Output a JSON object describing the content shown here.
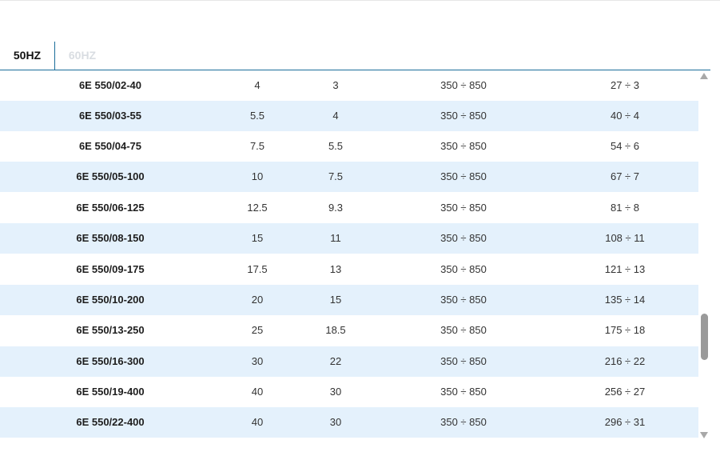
{
  "tabs": [
    {
      "label": "50HZ",
      "active": true
    },
    {
      "label": "60HZ",
      "active": false
    }
  ],
  "colors": {
    "accent": "#1a6d9a",
    "row_alt_bg": "#e4f1fc",
    "inactive_tab": "#d9dde2"
  },
  "table": {
    "rows": [
      [
        "6E 550/02-40",
        "4",
        "3",
        "350 ÷ 850",
        "27 ÷ 3"
      ],
      [
        "6E 550/03-55",
        "5.5",
        "4",
        "350 ÷ 850",
        "40 ÷ 4"
      ],
      [
        "6E 550/04-75",
        "7.5",
        "5.5",
        "350 ÷ 850",
        "54 ÷ 6"
      ],
      [
        "6E 550/05-100",
        "10",
        "7.5",
        "350 ÷ 850",
        "67 ÷ 7"
      ],
      [
        "6E 550/06-125",
        "12.5",
        "9.3",
        "350 ÷ 850",
        "81 ÷ 8"
      ],
      [
        "6E 550/08-150",
        "15",
        "11",
        "350 ÷ 850",
        "108 ÷ 11"
      ],
      [
        "6E 550/09-175",
        "17.5",
        "13",
        "350 ÷ 850",
        "121 ÷ 13"
      ],
      [
        "6E 550/10-200",
        "20",
        "15",
        "350 ÷ 850",
        "135 ÷ 14"
      ],
      [
        "6E 550/13-250",
        "25",
        "18.5",
        "350 ÷ 850",
        "175 ÷ 18"
      ],
      [
        "6E 550/16-300",
        "30",
        "22",
        "350 ÷ 850",
        "216 ÷ 22"
      ],
      [
        "6E 550/19-400",
        "40",
        "30",
        "350 ÷ 850",
        "256 ÷ 27"
      ],
      [
        "6E 550/22-400",
        "40",
        "30",
        "350 ÷ 850",
        "296 ÷ 31"
      ]
    ]
  },
  "scrollbar": {
    "up_icon": "triangle-up-icon",
    "down_icon": "triangle-down-icon",
    "position_fraction": 0.7
  }
}
